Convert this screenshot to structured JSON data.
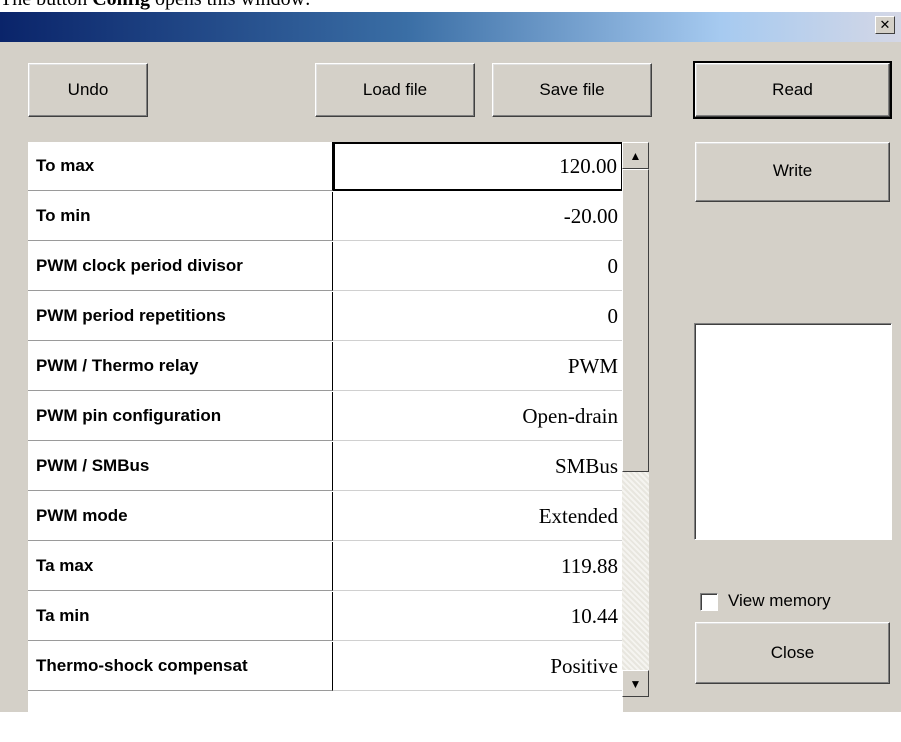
{
  "caption": {
    "prefix": "The button ",
    "bold": "Config",
    "suffix": " opens this window:"
  },
  "window": {
    "close_glyph": "✕"
  },
  "toolbar": {
    "undo": "Undo",
    "load_file": "Load file",
    "save_file": "Save file",
    "read": "Read",
    "write": "Write",
    "close": "Close"
  },
  "options": {
    "view_memory_label": "View memory",
    "view_memory_checked": false
  },
  "grid": {
    "rows": [
      {
        "name": "To max",
        "value": "120.00"
      },
      {
        "name": "To min",
        "value": "-20.00"
      },
      {
        "name": "PWM clock period divisor",
        "value": "0"
      },
      {
        "name": "PWM period repetitions",
        "value": "0"
      },
      {
        "name": "PWM / Thermo relay",
        "value": "PWM"
      },
      {
        "name": "PWM pin configuration",
        "value": "Open-drain"
      },
      {
        "name": "PWM / SMBus",
        "value": "SMBus"
      },
      {
        "name": "PWM mode",
        "value": "Extended"
      },
      {
        "name": "Ta max",
        "value": "119.88"
      },
      {
        "name": "Ta min",
        "value": "10.44"
      },
      {
        "name": "Thermo-shock compensat",
        "value": "Positive"
      }
    ]
  },
  "scrollbar": {
    "up_glyph": "▲",
    "down_glyph": "▼"
  }
}
